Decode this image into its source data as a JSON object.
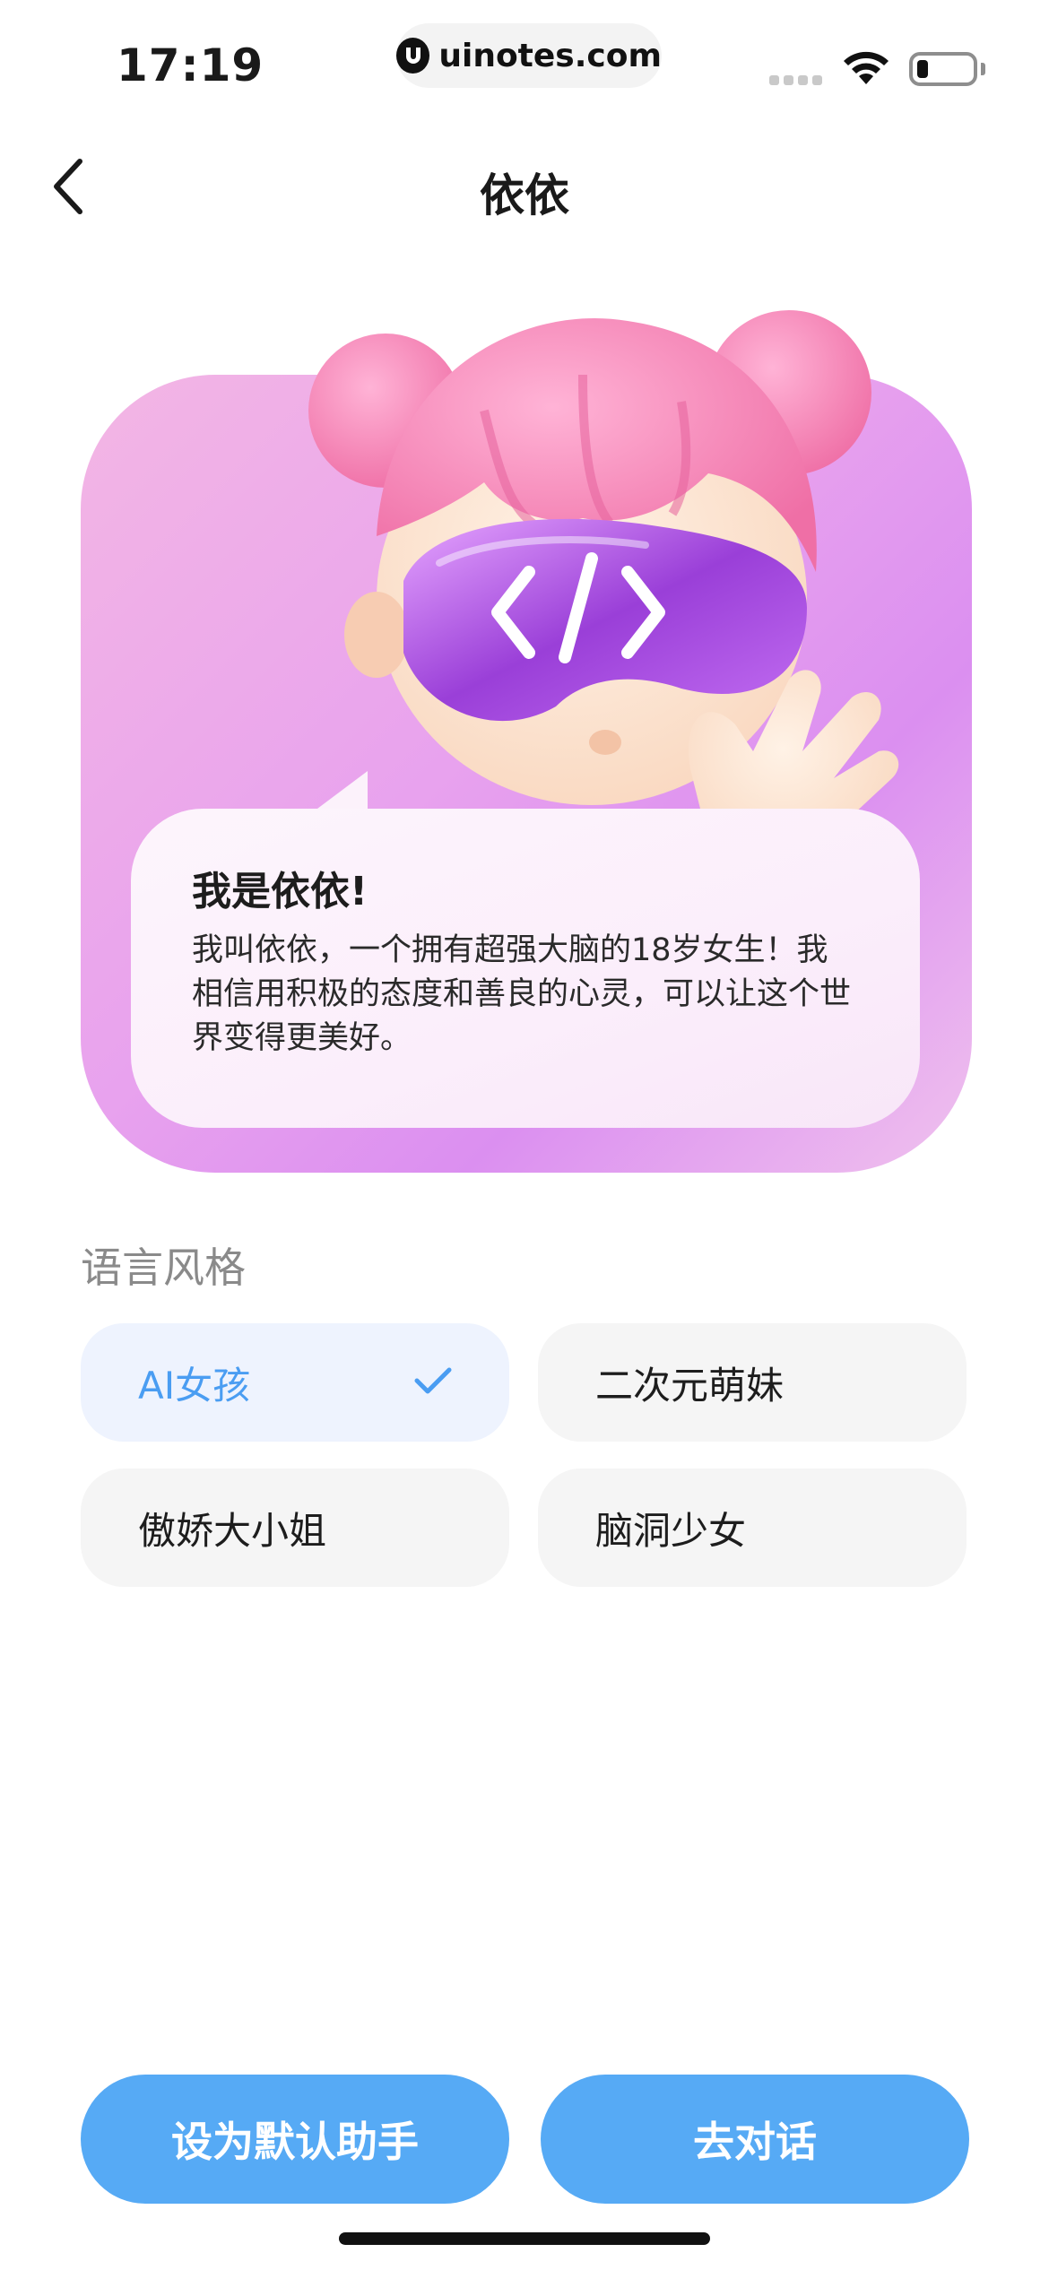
{
  "status_bar": {
    "time": "17:19",
    "url": "uinotes.com",
    "icons": [
      "signal-icon",
      "wifi-icon",
      "battery-icon"
    ],
    "battery_level": 0.15
  },
  "nav": {
    "back_icon": "chevron-left-icon",
    "title": "依依"
  },
  "hero": {
    "colors": {
      "gradient_start": "#f3b6e4",
      "gradient_mid": "#db8ff0",
      "gradient_end": "#f0c2ee"
    },
    "avatar": "ai-character-avatar",
    "intro_title": "我是依依!",
    "intro_text": "我叫依依，一个拥有超强大脑的18岁女生！我相信用积极的态度和善良的心灵，可以让这个世界变得更美好。"
  },
  "language_style": {
    "label": "语言风格",
    "options": [
      {
        "label": "AI女孩",
        "selected": true
      },
      {
        "label": "二次元萌妹",
        "selected": false
      },
      {
        "label": "傲娇大小姐",
        "selected": false
      },
      {
        "label": "脑洞少女",
        "selected": false
      }
    ],
    "selected_color": "#4a9df2"
  },
  "actions": {
    "set_default_label": "设为默认助手",
    "chat_label": "去对话",
    "button_color": "#56aaf5"
  }
}
